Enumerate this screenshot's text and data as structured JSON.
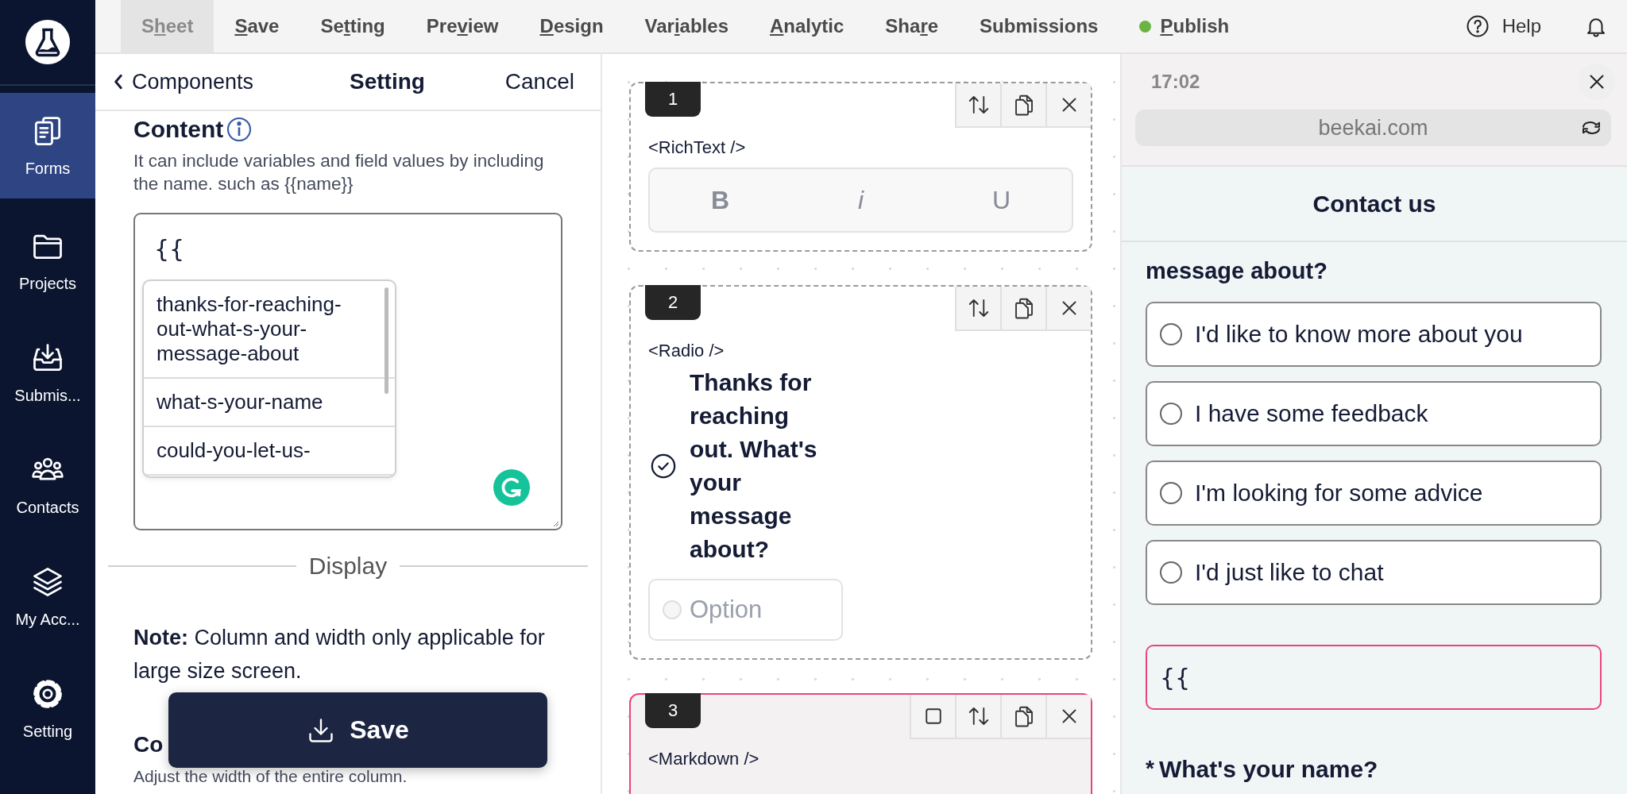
{
  "sidebar": {
    "items": [
      {
        "label": "Forms",
        "selected": true
      },
      {
        "label": "Projects",
        "selected": false
      },
      {
        "label": "Submis...",
        "selected": false
      },
      {
        "label": "Contacts",
        "selected": false
      },
      {
        "label": "My Acc...",
        "selected": false
      },
      {
        "label": "Setting",
        "selected": false
      }
    ]
  },
  "menu": [
    {
      "before": "S",
      "key": "h",
      "after": "eet",
      "selected": true
    },
    {
      "key": "S",
      "after": "ave",
      "selected": false
    },
    {
      "before": "Se",
      "key": "t",
      "after": "ting",
      "selected": false
    },
    {
      "before": "Pre",
      "key": "v",
      "after": "iew",
      "selected": false
    },
    {
      "key": "D",
      "after": "esign",
      "selected": false
    },
    {
      "before": "Var",
      "key": "i",
      "after": "ables",
      "selected": false
    },
    {
      "key": "A",
      "after": "nalytic",
      "selected": false
    },
    {
      "before": "Sha",
      "key": "r",
      "after": "e",
      "selected": false
    },
    {
      "before": "Submissions",
      "selected": false
    },
    {
      "key": "P",
      "after": "ublish",
      "selected": false,
      "color": "#6ab441"
    }
  ],
  "help": "Help",
  "settings_panel": {
    "back": "Components",
    "title": "Setting",
    "cancel": "Cancel",
    "content": {
      "title": "Content",
      "description": "It can include variables and field values by including the name. such as {{name}}",
      "value": "{{",
      "suggestions": [
        "thanks-for-reaching-out-what-s-your-message-about",
        "what-s-your-name",
        "could-you-let-us-"
      ]
    },
    "display_heading": "Display",
    "note": "**Note:** Column and width only applicable for large size screen.",
    "column_heading": "Co",
    "column_description": "Adjust the width of the entire column.",
    "save_button": "Save"
  },
  "canvas": {
    "components": [
      {
        "number": "1",
        "kind": "richtext",
        "tag": "<RichText />",
        "selected": false,
        "toolbar": [
          "B",
          "i",
          "U"
        ]
      },
      {
        "number": "2",
        "kind": "radio",
        "tag": "<Radio />",
        "selected": false,
        "question": "Thanks for reaching out. What's your message about?",
        "option_placeholder": "Option"
      },
      {
        "number": "3",
        "kind": "markdown",
        "tag": "<Markdown />",
        "selected": true
      }
    ]
  },
  "preview": {
    "time": "17:02",
    "url": "beekai.com",
    "title": "Contact us",
    "question_tail": "message about?",
    "options": [
      {
        "label": "I'd like to know more about you",
        "selected": false
      },
      {
        "label": "I have some feedback",
        "selected": false
      },
      {
        "label": "I'm looking for some advice",
        "selected": false
      },
      {
        "label": "I'd just like to chat",
        "selected": false
      }
    ],
    "text_value": "{{",
    "next_question": "What's your name?",
    "required_mark": "*"
  }
}
